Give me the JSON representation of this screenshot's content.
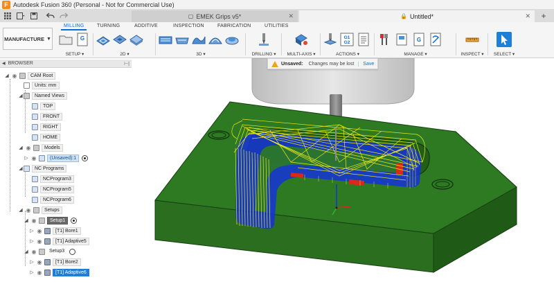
{
  "app": {
    "title": "Autodesk Fusion 360 (Personal - Not for Commercial Use)",
    "logo_letter": "F"
  },
  "doc_tabs": [
    {
      "label": "EMEK Grips v5*",
      "active": false
    },
    {
      "label": "Untitled*",
      "active": true
    }
  ],
  "toolbar": {
    "workspace": "MANUFACTURE",
    "tabs": [
      "MILLING",
      "TURNING",
      "ADDITIVE",
      "INSPECTION",
      "FABRICATION",
      "UTILITIES"
    ],
    "active_tab": "MILLING",
    "groups": {
      "setup": "SETUP",
      "two_d": "2D",
      "three_d": "3D",
      "drilling": "DRILLING",
      "multi_axis": "MULTI-AXIS",
      "actions": "ACTIONS",
      "manage": "MANAGE",
      "inspect": "INSPECT",
      "select": "SELECT"
    },
    "actions_g1g2": "G1\nG2"
  },
  "browser": {
    "title": "BROWSER",
    "root": "CAM Root",
    "units": "Units: mm",
    "named_views": "Named Views",
    "views": [
      "TOP",
      "FRONT",
      "RIGHT",
      "HOME"
    ],
    "models": "Models",
    "model_item": "(Unsaved):1",
    "nc_programs": "NC Programs",
    "programs": [
      "NCProgram3",
      "NCProgram5",
      "NCProgram6"
    ],
    "setups": "Setups",
    "setup1": "Setup1",
    "setup1_ops": [
      "[T1] Bore1",
      "[T1] Adaptive5"
    ],
    "setup3": "Setup3",
    "setup3_ops": [
      "[T1] Bore2",
      "[T1] Adaptive6"
    ]
  },
  "notification": {
    "title": "Unsaved:",
    "message": "Changes may be lost",
    "action": "Save"
  },
  "colors": {
    "stock_green": "#2e7a22",
    "toolpath_yellow": "#f5f21a",
    "toolpath_blue": "#1432d8",
    "plunge_red": "#d82a18",
    "accent": "#0a6cd6"
  }
}
